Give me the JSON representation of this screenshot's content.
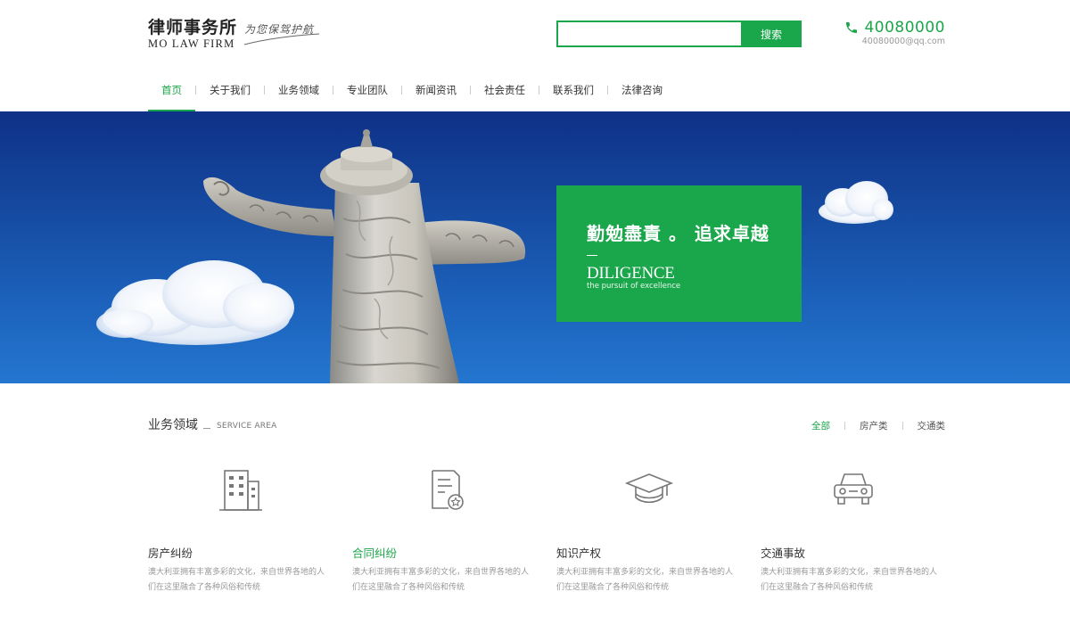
{
  "logo": {
    "cn": "律师事务所",
    "en": "MO LAW FIRM",
    "slogan": "为您保驾护航"
  },
  "search": {
    "placeholder": "",
    "button": "搜索"
  },
  "contact": {
    "phone": "40080000",
    "email": "40080000@qq.com"
  },
  "nav": {
    "items": [
      "首页",
      "关于我们",
      "业务领域",
      "专业团队",
      "新闻资讯",
      "社会责任",
      "联系我们",
      "法律咨询"
    ],
    "active_index": 0
  },
  "banner": {
    "title": "勤勉盡責 。 追求卓越",
    "en": "DILIGENCE",
    "sub": "the pursuit of excellence"
  },
  "service": {
    "title": "业务领域",
    "en": "SERVICE AREA",
    "filters": [
      "全部",
      "房产类",
      "交通类"
    ],
    "active_filter": 0,
    "cards": [
      {
        "icon": "building-icon",
        "title": "房产纠纷",
        "desc": "澳大利亚拥有丰富多彩的文化，来自世界各地的人们在这里融合了各种风俗和传统"
      },
      {
        "icon": "certificate-icon",
        "title": "合同纠纷",
        "desc": "澳大利亚拥有丰富多彩的文化，来自世界各地的人们在这里融合了各种风俗和传统"
      },
      {
        "icon": "graduation-cap-icon",
        "title": "知识产权",
        "desc": "澳大利亚拥有丰富多彩的文化，来自世界各地的人们在这里融合了各种风俗和传统"
      },
      {
        "icon": "car-icon",
        "title": "交通事故",
        "desc": "澳大利亚拥有丰富多彩的文化，来自世界各地的人们在这里融合了各种风俗和传统"
      }
    ],
    "highlight_index": 1
  },
  "colors": {
    "accent": "#1aa64a",
    "banner_top": "#0e3187",
    "banner_bottom": "#2476cf"
  }
}
